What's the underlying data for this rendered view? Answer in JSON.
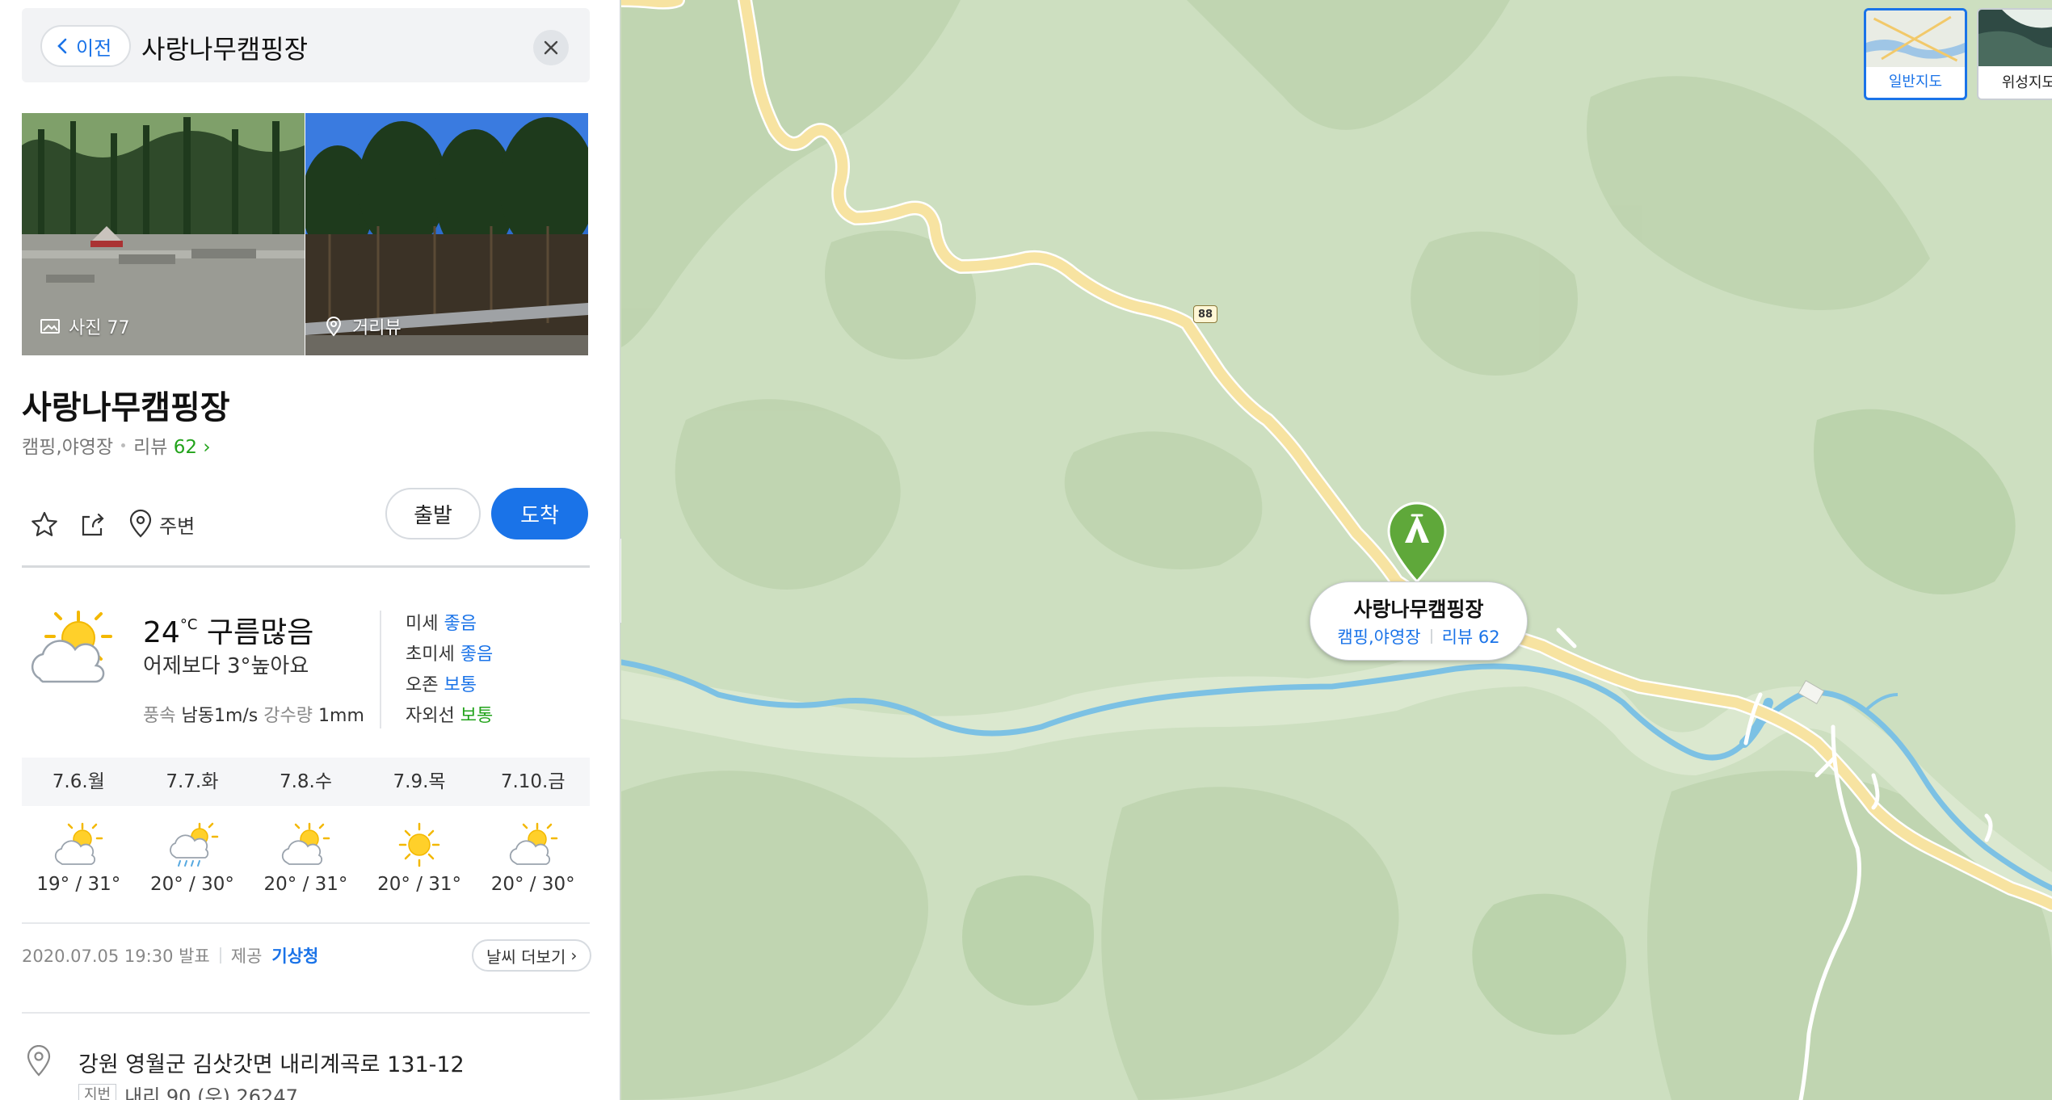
{
  "search": {
    "back_label": "이전",
    "query": "사랑나무캠핑장"
  },
  "photos": {
    "photo_label": "사진 77",
    "roadview_label": "거리뷰"
  },
  "place": {
    "name": "사랑나무캠핑장",
    "category": "캠핑,야영장",
    "review_label": "리뷰",
    "review_count": "62"
  },
  "actions": {
    "nearby_label": "주변",
    "depart_label": "출발",
    "arrive_label": "도착"
  },
  "weather": {
    "temp": "24",
    "unit": "°C",
    "condition": "구름많음",
    "compare": "어제보다 3°높아요",
    "wind_label": "풍속",
    "wind_value": "남동1m/s",
    "rain_label": "강수량",
    "rain_value": "1mm",
    "air": [
      {
        "label": "미세",
        "value": "좋음",
        "color": "#1a73e8"
      },
      {
        "label": "초미세",
        "value": "좋음",
        "color": "#1a73e8"
      },
      {
        "label": "오존",
        "value": "보통",
        "color": "#1a73e8"
      },
      {
        "label": "자외선",
        "value": "보통",
        "color": "#22a31b"
      }
    ],
    "forecast": [
      {
        "date": "7.6.월",
        "temp": "19° / 31°",
        "icon": "partly-cloudy-icon"
      },
      {
        "date": "7.7.화",
        "temp": "20° / 30°",
        "icon": "rain-sun-icon"
      },
      {
        "date": "7.8.수",
        "temp": "20° / 31°",
        "icon": "partly-cloudy-icon"
      },
      {
        "date": "7.9.목",
        "temp": "20° / 31°",
        "icon": "sunny-icon"
      },
      {
        "date": "7.10.금",
        "temp": "20° / 30°",
        "icon": "partly-cloudy-icon"
      }
    ],
    "issued": "2020.07.05 19:30 발표",
    "provider_label": "제공",
    "provider": "기상청",
    "more_label": "날씨 더보기"
  },
  "address": {
    "road": "강원 영월군 김삿갓면 내리계곡로 131-12",
    "jibun_badge": "지번",
    "jibun": "내리 90 (우) 26247"
  },
  "map": {
    "maptypes": [
      "일반지도",
      "위성지도"
    ],
    "route_number": "88",
    "callout_title": "사랑나무캠핑장",
    "callout_category": "캠핑,야영장",
    "callout_review": "리뷰 62"
  },
  "colors": {
    "accent": "#1a73e8",
    "review_green": "#22a31b",
    "marker_green": "#5fa83a",
    "road": "#f7e3a1",
    "river": "#7cc1e4",
    "land": "#cfe0c2"
  }
}
